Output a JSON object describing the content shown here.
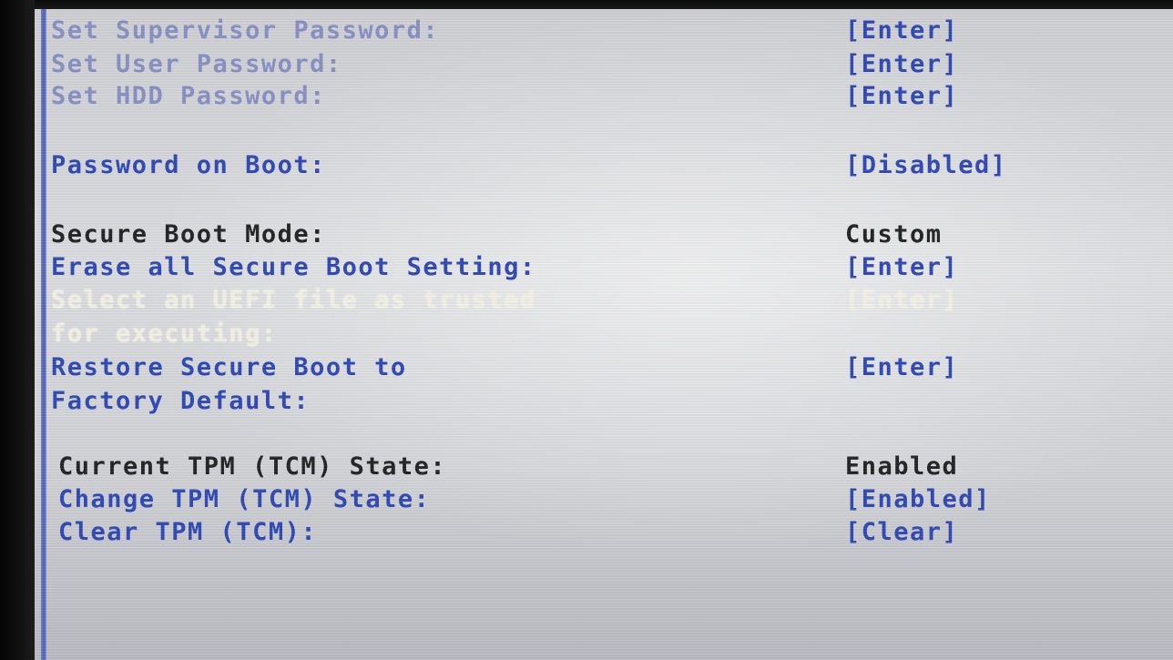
{
  "settings": [
    {
      "label": "Set Supervisor Password:",
      "value": "[Enter]"
    },
    {
      "label": "Set User Password:",
      "value": "[Enter]"
    },
    {
      "label": "Set HDD Password:",
      "value": "[Enter]"
    },
    {
      "label": "Password on Boot:",
      "value": "[Disabled]"
    },
    {
      "label": "Secure Boot Mode:",
      "value": "Custom"
    },
    {
      "label": "Erase all Secure Boot Setting:",
      "value": "[Enter]"
    },
    {
      "label": "Select an UEFI file as trusted",
      "label2": "for executing:",
      "value": "[Enter]"
    },
    {
      "label": "Restore Secure Boot to",
      "label2": "Factory Default:",
      "value": "[Enter]"
    },
    {
      "label": "Current TPM (TCM) State:",
      "value": "Enabled"
    },
    {
      "label": "Change TPM (TCM) State:",
      "value": "[Enabled]"
    },
    {
      "label": "Clear TPM (TCM):",
      "value": "[Clear]"
    }
  ],
  "colors": {
    "item": "#2f49b6",
    "item_dim": "#8890c4",
    "readonly": "#232323",
    "selected": "#f4f1e4",
    "panel_border": "#4b5fb8"
  }
}
